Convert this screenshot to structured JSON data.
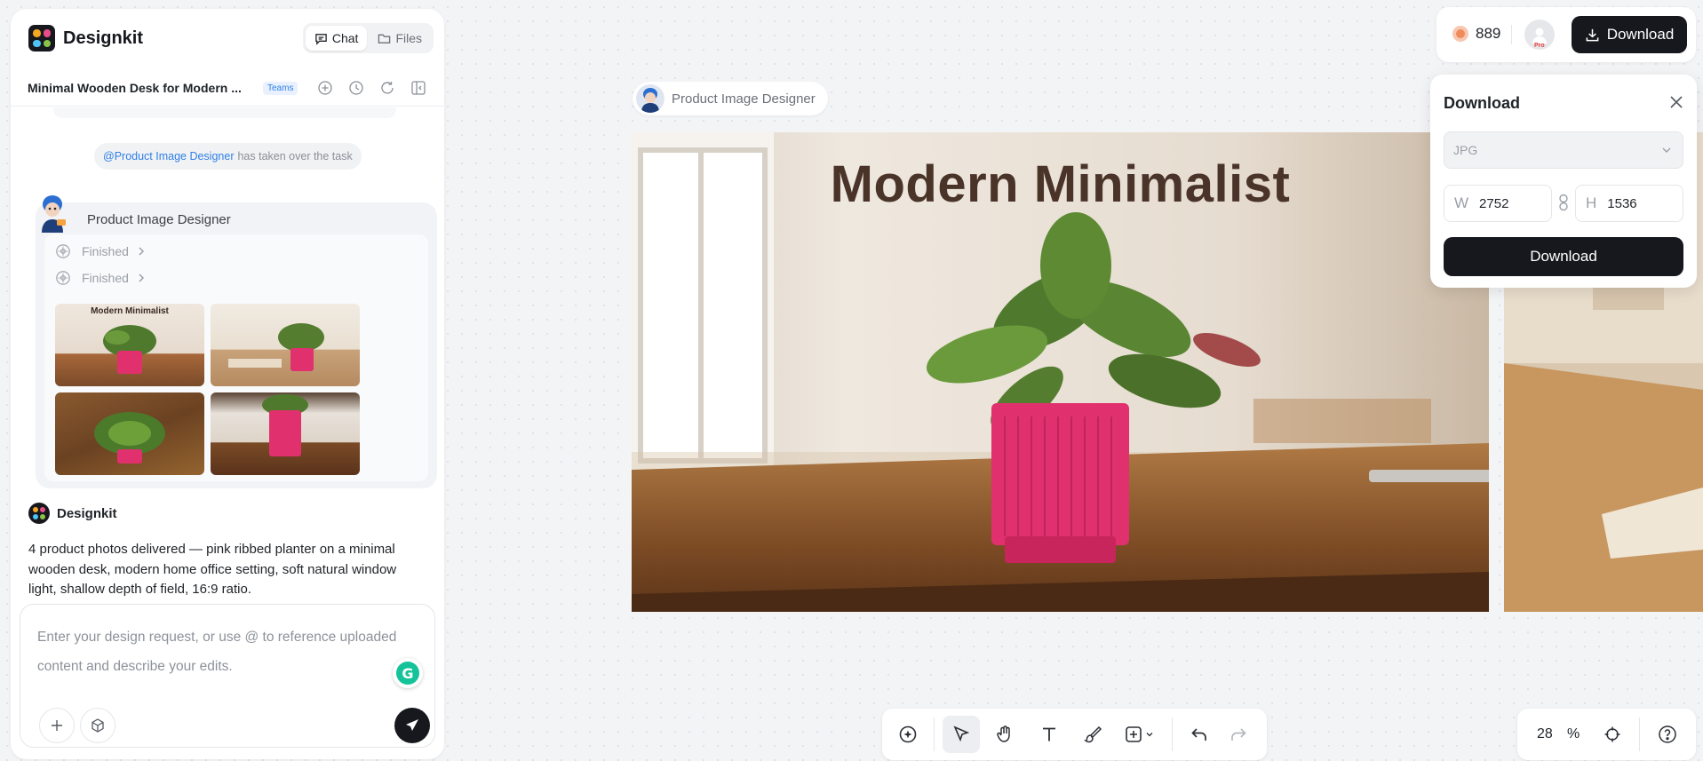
{
  "app": {
    "name": "Designkit",
    "logo_dots": [
      "#f5a623",
      "#e84d8a",
      "#4fc3f7",
      "#8bc34a"
    ],
    "tabs": [
      {
        "label": "Chat",
        "icon": "chat-icon",
        "active": true
      },
      {
        "label": "Files",
        "icon": "folder-icon",
        "active": false
      }
    ]
  },
  "project": {
    "title": "Minimal Wooden Desk for Modern ...",
    "badge": "Teams",
    "icons": [
      "add-circle-icon",
      "history-icon",
      "refresh-icon",
      "panel-collapse-icon"
    ]
  },
  "chat": {
    "takeover": {
      "mention": "@Product Image Designer",
      "text": "has taken over the task"
    },
    "agent": {
      "name": "Product Image Designer",
      "steps": [
        {
          "label": "Finished"
        },
        {
          "label": "Finished"
        }
      ],
      "thumbnails": [
        {
          "caption": "Modern Minimalist"
        },
        {
          "caption": ""
        },
        {
          "caption": ""
        },
        {
          "caption": ""
        }
      ]
    },
    "reply": {
      "author": "Designkit",
      "text": "4 product photos delivered — pink ribbed planter on a minimal wooden desk, modern home office setting, soft natural window light, shallow depth of field, 16:9 ratio."
    }
  },
  "composer": {
    "placeholder": "Enter your design request, or use @ to reference uploaded content and describe your edits.",
    "grammarly_label": "G"
  },
  "canvas": {
    "frame_label": "Product Image Designer",
    "main_image_title": "Modern Minimalist"
  },
  "topbar": {
    "credits": "889",
    "avatar_badge": "Pro",
    "download_label": "Download"
  },
  "download_panel": {
    "title": "Download",
    "format": "JPG",
    "width_label": "W",
    "width": "2752",
    "height_label": "H",
    "height": "1536",
    "button_label": "Download"
  },
  "toolbar": {
    "tools": [
      "ai-add-icon",
      "select-cursor-icon",
      "hand-pan-icon",
      "text-icon",
      "brush-icon",
      "insert-icon",
      "undo-icon",
      "redo-icon"
    ],
    "active_tool": "select-cursor-icon"
  },
  "zoom": {
    "value": "28",
    "unit": "%"
  },
  "colors": {
    "accent": "#16181d",
    "link": "#2f7fe8",
    "planter": "#e0306e"
  }
}
